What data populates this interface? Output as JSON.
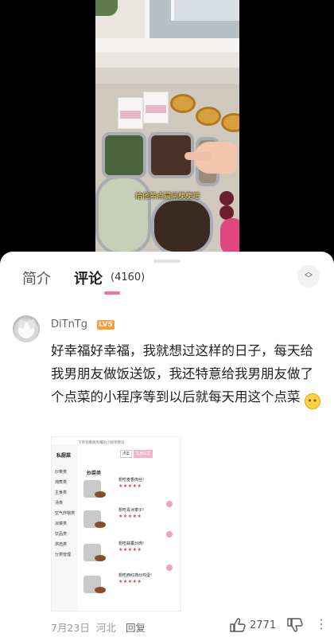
{
  "video": {
    "caption": "给他带点晨间梗梗吧"
  },
  "tabs": {
    "intro": "简介",
    "comments": "评论",
    "comment_count": "(4160)"
  },
  "comment": {
    "username": "DiTnTg",
    "level": "LV5",
    "text": "好幸福好幸福，我就想过这样的日子，每天给我男朋友做饭送饭，我还特意给我男朋友做了个点菜的小程序等到以后就每天用这个点菜",
    "emoji": "😗",
    "date": "7月23日",
    "location": "河北",
    "reply_label": "回复",
    "likes": "2771"
  },
  "shared_image": {
    "header": "下单到看厨房赚的小程序我说",
    "sidebar_title": "私厨菜",
    "sidebar_items": [
      "炒菜类",
      "炖煮类",
      "主食类",
      "汤类",
      "空气炸锅类",
      "凉菜类",
      "饮品类",
      "烘焙类",
      "分类管理"
    ],
    "top_tabs": [
      "点菜",
      "私厨日志"
    ],
    "category": "炒菜类",
    "dishes": [
      {
        "name": "想吃麦香肉丝!",
        "stars": "★★★★★"
      },
      {
        "name": "想吃青冰菜子!",
        "stars": "★★★★★"
      },
      {
        "name": "想吃蒜薹炒肉!",
        "stars": "★★★★★"
      },
      {
        "name": "想吃西红柿炒鸡蛋!",
        "stars": "★★★★★"
      }
    ]
  },
  "colors": {
    "accent": "#fb7299",
    "level_badge": "#ff9a3b"
  }
}
